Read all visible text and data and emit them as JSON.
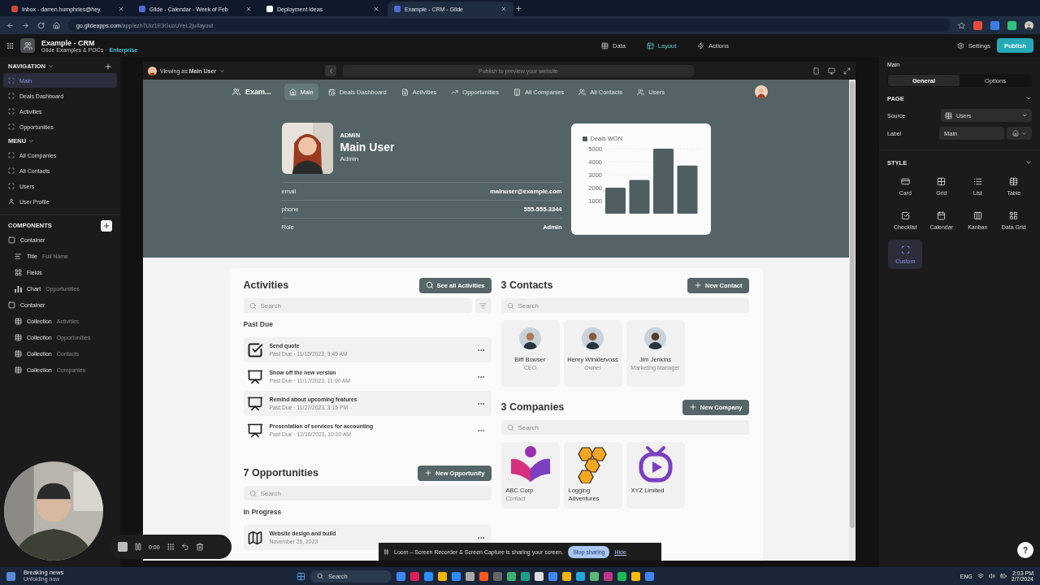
{
  "browser": {
    "tabs": [
      {
        "title": "Inbox - darren.humphries@hey",
        "kind": "mail",
        "selected": false
      },
      {
        "title": "Glide - Calendar - Week of Feb",
        "kind": "glide",
        "selected": false
      },
      {
        "title": "Deployment ideas",
        "kind": "notion",
        "selected": false
      },
      {
        "title": "Example - CRM - Glide",
        "kind": "glide",
        "selected": true
      }
    ],
    "url_host": "go.glideapps.com",
    "url_path": "/app/ezh7Uiz1E3GuoUYeL2ju/layout"
  },
  "app_header": {
    "title": "Example - CRM",
    "subtitle": "Glide Examples & POCs ·",
    "plan": "Enterprise",
    "tabs": [
      {
        "label": "Data",
        "kind": "data",
        "selected": false
      },
      {
        "label": "Layout",
        "kind": "layout",
        "selected": true
      },
      {
        "label": "Actions",
        "kind": "actions",
        "selected": false
      }
    ],
    "settings": "Settings",
    "publish": "Publish"
  },
  "sidebar": {
    "sections": [
      {
        "title": "NAVIGATION",
        "add": true,
        "items": [
          {
            "label": "Main",
            "kind": "page",
            "selected": true
          },
          {
            "label": "Deals Dashboard",
            "kind": "page",
            "selected": false
          },
          {
            "label": "Activities",
            "kind": "page",
            "selected": false
          },
          {
            "label": "Opportunities",
            "kind": "page",
            "selected": false
          }
        ]
      },
      {
        "title": "MENU",
        "add": false,
        "items": [
          {
            "label": "All Companies",
            "kind": "page",
            "selected": false
          },
          {
            "label": "All Contacts",
            "kind": "page",
            "selected": false
          },
          {
            "label": "Users",
            "kind": "page",
            "selected": false
          },
          {
            "label": "User Profile",
            "kind": "profile",
            "selected": false
          }
        ]
      }
    ],
    "components_title": "COMPONENTS",
    "components": [
      {
        "label": "Container",
        "kind": "container",
        "children": [
          {
            "label": "Title",
            "detail": "Full Name",
            "kind": "title"
          },
          {
            "label": "Fields",
            "kind": "fields"
          },
          {
            "label": "Chart",
            "detail": "Opportunities",
            "kind": "chart"
          }
        ]
      },
      {
        "label": "Container",
        "kind": "container",
        "children": [
          {
            "label": "Collection",
            "detail": "Activities",
            "kind": "collection"
          },
          {
            "label": "Collection",
            "detail": "Opportunities",
            "kind": "collection"
          },
          {
            "label": "Collection",
            "detail": "Contacts",
            "kind": "collection"
          },
          {
            "label": "Collection",
            "detail": "Companies",
            "kind": "collection"
          }
        ]
      }
    ]
  },
  "preview": {
    "viewing_as": "Viewing as ",
    "viewer": "Main User",
    "url_placeholder": "Publish to preview your website",
    "nav": {
      "app_name": "Exam...",
      "items": [
        {
          "label": "Main",
          "kind": "home",
          "selected": true
        },
        {
          "label": "Deals Dashboard",
          "kind": "calendar",
          "selected": false
        },
        {
          "label": "Activities",
          "kind": "notes",
          "selected": false
        },
        {
          "label": "Opportunities",
          "kind": "steps",
          "selected": false
        },
        {
          "label": "All Companies",
          "kind": "building",
          "selected": false
        },
        {
          "label": "All Contacts",
          "kind": "people",
          "selected": false
        },
        {
          "label": "Users",
          "kind": "people",
          "selected": false
        }
      ]
    },
    "profile": {
      "role_caption": "ADMIN",
      "name": "Main User",
      "role": "Admin",
      "fields": [
        {
          "label": "email",
          "value": "mainuser@example.com"
        },
        {
          "label": "phone",
          "value": "555-555-3344"
        },
        {
          "label": "Role",
          "value": "Admin"
        }
      ]
    },
    "chart": {
      "chart_data": {
        "type": "bar",
        "grid": true,
        "series": [
          {
            "name": "Deals WON",
            "color": "#4f5e61",
            "values": [
              2000,
              2600,
              5000,
              3700
            ]
          }
        ],
        "ylim": [
          0,
          5000
        ],
        "yticks": [
          1000,
          2000,
          3000,
          4000,
          5000
        ]
      }
    },
    "activities": {
      "title": "Activities",
      "button": "See all Activities",
      "search_placeholder": "Search",
      "group": "Past Due",
      "items": [
        {
          "kind": "check",
          "title": "Send quote",
          "subtitle": "Past Due · 11/15/2023, 9:49 AM"
        },
        {
          "kind": "screen",
          "title": "Show off the new version",
          "subtitle": "Past Due · 11/17/2023, 11:00 AM"
        },
        {
          "kind": "screen",
          "title": "Remind about upcoming features",
          "subtitle": "Past Due · 11/27/2023, 3:15 PM"
        },
        {
          "kind": "screen",
          "title": "Presentation of services for accounting",
          "subtitle": "Past Due · 12/16/2023, 10:00 AM"
        }
      ]
    },
    "opportunities": {
      "title": "7 Opportunities",
      "button": "New Opportunity",
      "search_placeholder": "Search",
      "group": "In Progress",
      "items": [
        {
          "kind": "blueprint",
          "title": "Website design and build",
          "subtitle": "November 26, 2023"
        }
      ]
    },
    "contacts": {
      "title": "3 Contacts",
      "button": "New Contact",
      "search_placeholder": "Search",
      "items": [
        {
          "name": "Biff Bowser",
          "role": "CEO"
        },
        {
          "name": "Henry Winklervoss",
          "role": "Owner"
        },
        {
          "name": "Jim Jenkins",
          "role": "Marketing Manager"
        }
      ]
    },
    "companies": {
      "title": "3 Companies",
      "button": "New Company",
      "search_placeholder": "Search",
      "items": [
        {
          "kind": "book",
          "name": "ABC Corp",
          "detail": "Contact"
        },
        {
          "kind": "honeycomb",
          "name": "Logging Adventures"
        },
        {
          "kind": "tv",
          "name": "XYZ Limited"
        }
      ]
    }
  },
  "right_panel": {
    "title": "Main",
    "tabs": [
      {
        "label": "General",
        "selected": true
      },
      {
        "label": "Options",
        "selected": false
      }
    ],
    "page_section": "PAGE",
    "source_label": "Source",
    "source_value": "Users",
    "label_label": "Label",
    "label_value": "Main",
    "style_section": "STYLE",
    "styles": [
      {
        "kind": "card",
        "label": "Card",
        "selected": false
      },
      {
        "kind": "grid",
        "label": "Grid",
        "selected": false
      },
      {
        "kind": "list",
        "label": "List",
        "selected": false
      },
      {
        "kind": "table",
        "label": "Table",
        "selected": false
      },
      {
        "kind": "checklist",
        "label": "Checklist",
        "selected": false
      },
      {
        "kind": "calendar",
        "label": "Calendar",
        "selected": false
      },
      {
        "kind": "kanban",
        "label": "Kanban",
        "selected": false
      },
      {
        "kind": "datagrid",
        "label": "Data Grid",
        "selected": false
      },
      {
        "kind": "custom",
        "label": "Custom",
        "selected": true
      }
    ]
  },
  "recorder": {
    "time": "0:00"
  },
  "loom": {
    "message": "Loom – Screen Recorder & Screen Capture is sharing your screen.",
    "stop": "Stop sharing",
    "hide": "Hide"
  },
  "taskbar": {
    "news_title": "Breaking news",
    "news_subtitle": "Unfolding now",
    "search": "Search",
    "language": "ENG",
    "time": "2:03 PM",
    "date": "2/7/2024"
  },
  "help": "?"
}
